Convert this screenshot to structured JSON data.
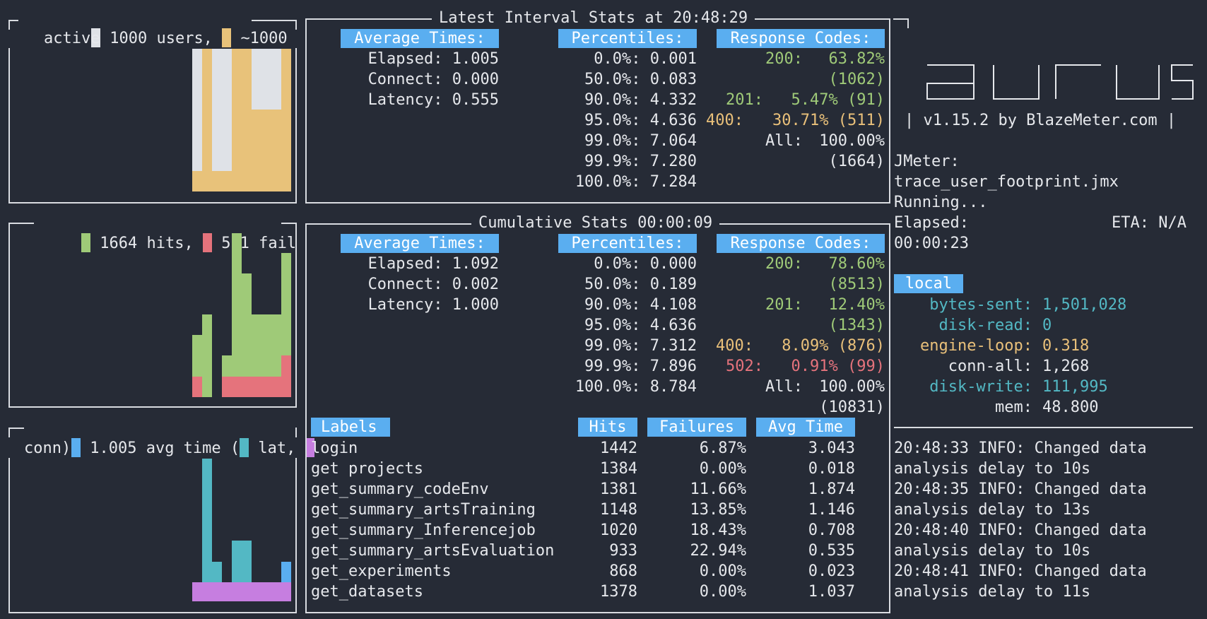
{
  "colors": {
    "background": "#262b36",
    "header": "#5aaef0",
    "users_active": "#e8c27a",
    "users_total": "#dfe2e7",
    "hits": "#9fca78",
    "fail": "#e5737c",
    "avg_time": "#5aaef0",
    "lat": "#53b8c4",
    "conn": "#c67ee0"
  },
  "users_panel": {
    "users_count": "1000 users,",
    "active_count": "~1000",
    "active_label": "active"
  },
  "hits_panel": {
    "hits": "1664 hits,",
    "fail": "511 fail"
  },
  "time_panel": {
    "avg": "1.005 avg time (",
    "lat": "lat,",
    "conn": "conn)"
  },
  "latest": {
    "title": "Latest Interval Stats at 20:48:29",
    "avg_header": "Average Times:",
    "pct_header": "Percentiles:",
    "codes_header": "Response Codes:",
    "avg_rows": [
      "Elapsed: 1.005",
      "Connect: 0.000",
      "Latency: 0.555"
    ],
    "pct_rows": [
      "0.0%: 0.001",
      "50.0%: 0.083",
      "90.0%: 4.332",
      "95.0%: 4.636",
      "99.0%: 7.064",
      "99.9%: 7.280",
      "100.0%: 7.284"
    ],
    "codes": [
      {
        "code": "200:",
        "pct": "63.82%",
        "count": "(1062)"
      },
      {
        "code": "201:",
        "pct": "5.47% (91)"
      },
      {
        "code": "400:",
        "pct": "30.71% (511)"
      },
      {
        "code": "All:",
        "pct": "100.00%",
        "count": "(1664)"
      }
    ]
  },
  "cumulative": {
    "title": "Cumulative Stats 00:00:09",
    "avg_header": "Average Times:",
    "pct_header": "Percentiles:",
    "codes_header": "Response Codes:",
    "avg_rows": [
      "Elapsed: 1.092",
      "Connect: 0.002",
      "Latency: 1.000"
    ],
    "pct_rows": [
      "0.0%: 0.000",
      "50.0%: 0.189",
      "90.0%: 4.108",
      "95.0%: 4.636",
      "99.0%: 7.312",
      "99.9%: 7.896",
      "100.0%: 8.784"
    ],
    "codes": [
      {
        "code": "200:",
        "pct": "78.60%",
        "count": "(8513)"
      },
      {
        "code": "201:",
        "pct": "12.40%",
        "count": "(1343)"
      },
      {
        "code": "400:",
        "pct": "8.09% (876)"
      },
      {
        "code": "502:",
        "pct": "0.91% (99)"
      },
      {
        "code": "All:",
        "pct": "100.00%",
        "count": "(10831)"
      }
    ]
  },
  "labels_table": {
    "headers": [
      "Labels",
      "Hits",
      "Failures",
      "Avg Time"
    ],
    "rows": [
      [
        "login",
        "1442",
        "6.87%",
        "3.043"
      ],
      [
        "get projects",
        "1384",
        "0.00%",
        "0.018"
      ],
      [
        "get_summary_codeEnv",
        "1381",
        "11.66%",
        "1.874"
      ],
      [
        "get_summary_artsTraining",
        "1148",
        "13.85%",
        "1.146"
      ],
      [
        "get_summary_Inferencejob",
        "1020",
        "18.43%",
        "0.708"
      ],
      [
        "get_summary_artsEvaluation",
        "933",
        "22.94%",
        "0.535"
      ],
      [
        "get_experiments",
        "868",
        "0.00%",
        "0.023"
      ],
      [
        "get_datasets",
        "1378",
        "0.00%",
        "1.037"
      ]
    ]
  },
  "sidebar": {
    "version": "| v1.15.2 by BlazeMeter.com |",
    "tool": "JMeter:",
    "script": "trace_user_footprint.jmx",
    "status": "Running...",
    "elapsed_label": "Elapsed:",
    "eta": "ETA: N/A",
    "elapsed_value": "00:00:23",
    "local_header": "local",
    "metrics": [
      {
        "name": "bytes-sent:",
        "value": "1,501,028"
      },
      {
        "name": "disk-read:",
        "value": "0"
      },
      {
        "name": "engine-loop:",
        "value": "0.318"
      },
      {
        "name": "conn-all:",
        "value": "1,268"
      },
      {
        "name": "disk-write:",
        "value": "111,995"
      },
      {
        "name": "mem:",
        "value": "48.800"
      }
    ],
    "log": [
      "20:48:33 INFO: Changed data",
      "analysis delay to 10s",
      "20:48:35 INFO: Changed data",
      "analysis delay to 13s",
      "20:48:40 INFO: Changed data",
      "analysis delay to 10s",
      "20:48:41 INFO: Changed data",
      "analysis delay to 11s"
    ]
  }
}
